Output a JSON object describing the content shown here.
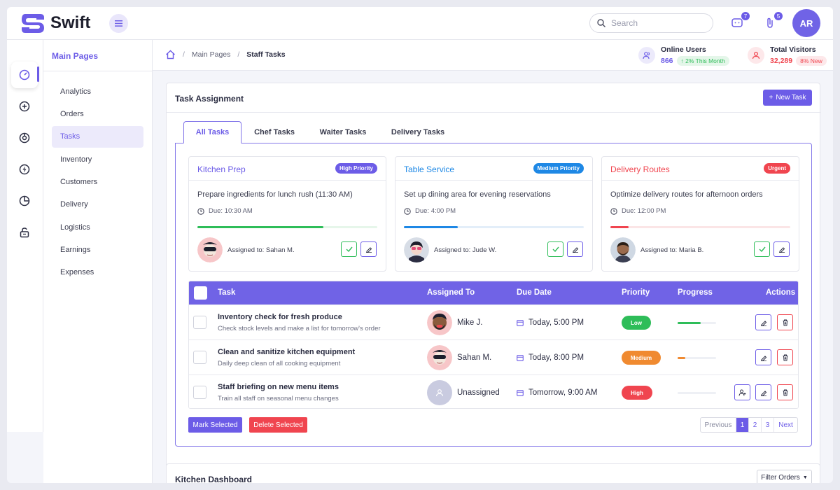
{
  "app": {
    "name": "Swift"
  },
  "header": {
    "search_placeholder": "Search",
    "messages_count": "7",
    "attachments_count": "5",
    "user_initials": "AR"
  },
  "sidebar": {
    "title": "Main Pages",
    "items": [
      "Analytics",
      "Orders",
      "Tasks",
      "Inventory",
      "Customers",
      "Delivery",
      "Logistics",
      "Earnings",
      "Expenses"
    ],
    "active_index": 2
  },
  "breadcrumb": {
    "parent": "Main Pages",
    "current": "Staff Tasks",
    "separator": "/"
  },
  "stats": {
    "online": {
      "label": "Online Users",
      "value": "866",
      "delta": "2% This Month"
    },
    "visitors": {
      "label": "Total Visitors",
      "value": "32,289",
      "delta": "8% New"
    }
  },
  "task_card": {
    "title": "Task Assignment",
    "new_task_label": "New Task",
    "tabs": [
      "All Tasks",
      "Chef Tasks",
      "Waiter Tasks",
      "Delivery Tasks"
    ],
    "active_tab": 0
  },
  "featured": [
    {
      "title": "Kitchen Prep",
      "badge": "High Priority",
      "badge_color": "#6c5ce7",
      "title_color": "#6c5ce7",
      "desc": "Prepare ingredients for lunch rush (11:30 AM)",
      "due": "Due: 10:30 AM",
      "progress": 0.7,
      "bar_color": "#2ebd59",
      "track_color": "#e6f6ea",
      "assigned": "Assigned to: Sahan M."
    },
    {
      "title": "Table Service",
      "badge": "Medium Priority",
      "badge_color": "#1e88e5",
      "title_color": "#1e88e5",
      "desc": "Set up dining area for evening reservations",
      "due": "Due: 4:00 PM",
      "progress": 0.3,
      "bar_color": "#1e88e5",
      "track_color": "#e3eef9",
      "assigned": "Assigned to: Jude W."
    },
    {
      "title": "Delivery Routes",
      "badge": "Urgent",
      "badge_color": "#f0454f",
      "title_color": "#f0454f",
      "desc": "Optimize delivery routes for afternoon orders",
      "due": "Due: 12:00 PM",
      "progress": 0.1,
      "bar_color": "#f0454f",
      "track_color": "#fbe5e6",
      "assigned": "Assigned to: Maria B."
    }
  ],
  "table": {
    "headers": [
      "Task",
      "Assigned To",
      "Due Date",
      "Priority",
      "Progress",
      "Actions"
    ],
    "rows": [
      {
        "title": "Inventory check for fresh produce",
        "sub": "Check stock levels and make a list for tomorrow's order",
        "assignee": "Mike J.",
        "due": "Today, 5:00 PM",
        "priority": "Low",
        "priority_color": "#2ebd59",
        "progress": 0.6,
        "progress_color": "#2ebd59"
      },
      {
        "title": "Clean and sanitize kitchen equipment",
        "sub": "Daily deep clean of all cooking equipment",
        "assignee": "Sahan M.",
        "due": "Today, 8:00 PM",
        "priority": "Medium",
        "priority_color": "#f08a30",
        "progress": 0.2,
        "progress_color": "#f08a30"
      },
      {
        "title": "Staff briefing on new menu items",
        "sub": "Train all staff on seasonal menu changes",
        "assignee": "Unassigned",
        "due": "Tomorrow, 9:00 AM",
        "priority": "High",
        "priority_color": "#f0454f",
        "progress": 0.0,
        "progress_color": "#f0454f"
      }
    ]
  },
  "bulk": {
    "mark_label": "Mark Selected",
    "delete_label": "Delete Selected"
  },
  "pagination": {
    "previous": "Previous",
    "pages": [
      "1",
      "2",
      "3"
    ],
    "next": "Next",
    "current": "1"
  },
  "kitchen": {
    "title": "Kitchen Dashboard",
    "filter_label": "Filter Orders"
  },
  "colors": {
    "accent": "#6c5ce7",
    "danger": "#f0454f",
    "success": "#2ebd59"
  }
}
